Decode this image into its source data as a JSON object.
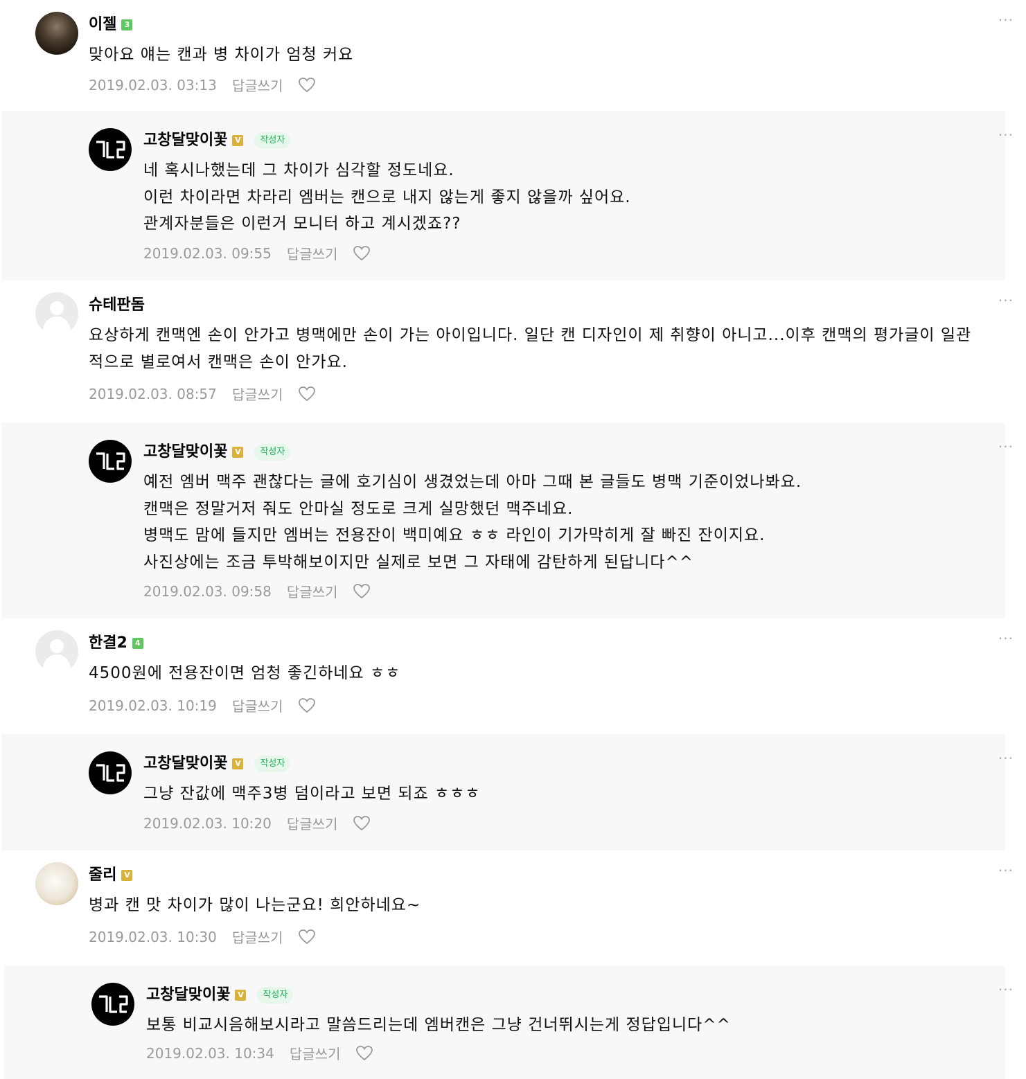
{
  "ui": {
    "reply_label": "답글쓰기",
    "more_label": "···",
    "author_tag": "작성자"
  },
  "comments": [
    {
      "nickname": "이젤",
      "badge": "3",
      "text": "맞아요 얘는 캔과 병 차이가 엄청 커요",
      "date": "2019.02.03. 03:13"
    },
    {
      "nickname": "고창달맞이꽃",
      "badge": "V",
      "text": "네 혹시나했는데 그 차이가 심각할 정도네요.\n이런 차이라면 차라리 엠버는 캔으로 내지 않는게 좋지 않을까 싶어요.\n관계자분들은 이런거 모니터 하고 계시겠죠??",
      "date": "2019.02.03. 09:55"
    },
    {
      "nickname": "슈테판돔",
      "text": "요상하게 캔맥엔 손이 안가고 병맥에만 손이 가는 아이입니다. 일단 캔 디자인이 제 취향이 아니고...이후 캔맥의 평가글이 일관적으로 별로여서 캔맥은 손이 안가요.",
      "date": "2019.02.03. 08:57"
    },
    {
      "nickname": "고창달맞이꽃",
      "badge": "V",
      "text": "예전 엠버 맥주 괜찮다는 글에 호기심이 생겼었는데 아마 그때 본 글들도 병맥 기준이었나봐요.\n캔맥은 정말거저 줘도 안마실 정도로 크게 실망했던 맥주네요.\n병맥도 맘에 들지만 엠버는 전용잔이 백미예요 ㅎㅎ 라인이 기가막히게 잘 빠진 잔이지요.\n사진상에는 조금 투박해보이지만 실제로 보면 그 자태에 감탄하게 된답니다^^",
      "date": "2019.02.03. 09:58"
    },
    {
      "nickname": "한결2",
      "badge": "4",
      "text": "4500원에 전용잔이면 엄청 좋긴하네요 ㅎㅎ",
      "date": "2019.02.03. 10:19"
    },
    {
      "nickname": "고창달맞이꽃",
      "badge": "V",
      "text": "그냥 잔값에 맥주3병 덤이라고 보면 되죠 ㅎㅎㅎ",
      "date": "2019.02.03. 10:20"
    },
    {
      "nickname": "줄리",
      "badge": "V",
      "text": "병과 캔 맛 차이가 많이 나는군요! 희안하네요~",
      "date": "2019.02.03. 10:30"
    },
    {
      "nickname": "고창달맞이꽃",
      "badge": "V",
      "text": "보통 비교시음해보시라고 말씀드리는데 엠버캔은 그냥 건너뛰시는게 정답입니다^^",
      "date": "2019.02.03. 10:34"
    }
  ],
  "colors": {
    "reply_bg": "#f8f8f8",
    "level_badge": "#5ec85e",
    "verified_badge": "#d9b13b",
    "author_tag_text": "#1eb05a",
    "author_tag_bg": "#e7f7ec",
    "meta_text": "#999999"
  }
}
